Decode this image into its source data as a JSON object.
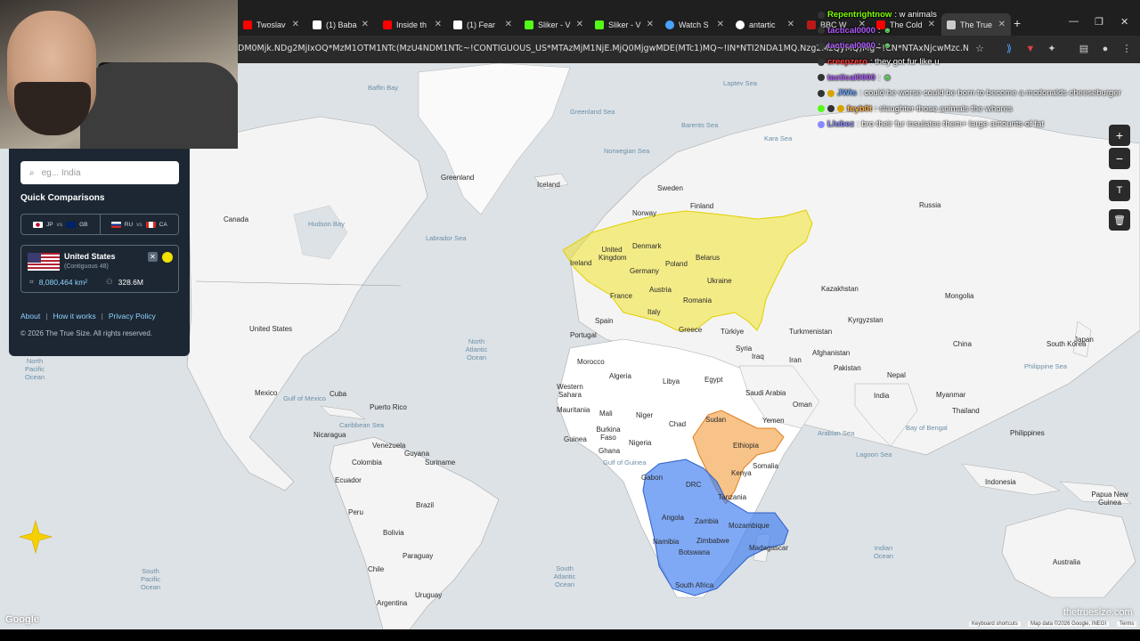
{
  "browser": {
    "tabs": [
      {
        "label": "Twoslav",
        "color": "#ff0000"
      },
      {
        "label": "(1) Baba",
        "color": "#ffffff"
      },
      {
        "label": "Inside th",
        "color": "#ff0000"
      },
      {
        "label": "(1) Fear",
        "color": "#ffffff"
      },
      {
        "label": "Sliker - V",
        "color": "#53fc18"
      },
      {
        "label": "Sliker - V",
        "color": "#53fc18"
      },
      {
        "label": "Watch S",
        "color": "#4aa3ff"
      },
      {
        "label": "antartic",
        "color": "#ffffff"
      },
      {
        "label": "BBC W",
        "color": "#bb1919"
      },
      {
        "label": "The Cold",
        "color": "#ff0000"
      },
      {
        "label": "The True",
        "color": "#cccccc"
      }
    ],
    "url": "DM0Mjk.NDg2MjIxOQ*MzM1OTM1NTc(MzU4NDM1NTc~!CONTIGUOUS_US*MTAzMjM1NjE.MjQ0MjgwMDE(MTc1)MQ~!IN*NTI2NDA1MQ.Nzg2MzQyMQ)Mg~!CN*NTAxNjcwMzc.Njk4NDc0OQ(Mji..."
  },
  "panel": {
    "search_placeholder": "eg... India",
    "quick_comparisons_title": "Quick Comparisons",
    "comparisons": [
      {
        "a": "JP",
        "vs": "vs",
        "b": "GB"
      },
      {
        "a": "RU",
        "vs": "vs",
        "b": "CA"
      }
    ],
    "selected": {
      "name": "United States",
      "subtitle": "(Contiguous 48)",
      "area": "8,080,464 km²",
      "population": "328.6M",
      "color": "#f2e000"
    },
    "links": [
      "About",
      "How it works",
      "Privacy Policy"
    ],
    "copyright": "© 2026 The True Size. All rights reserved."
  },
  "chat": [
    {
      "user": "Repentrightnow",
      "text": ": w animals",
      "color": "#7fff00"
    },
    {
      "user": "tactical0000",
      "text": ":",
      "color": "#b05cff"
    },
    {
      "user": "tactical0000",
      "text": ":",
      "color": "#b05cff"
    },
    {
      "user": "creepzero",
      "text": ": they got fur like u",
      "color": "#ff3b3b"
    },
    {
      "user": "tactical0000",
      "text": ":",
      "color": "#b05cff"
    },
    {
      "user": "JWis",
      "text": ": could be worse could be born to become a mcdonalds cheeseburger",
      "color": "#6fa8ff"
    },
    {
      "user": "feyb0t",
      "text": ": slaughter those animals the whores",
      "color": "#ffb347"
    },
    {
      "user": "Llubez",
      "text": ": bro their fur insulates them+ large amounts of fat",
      "color": "#8a8aff"
    }
  ],
  "map": {
    "labels": {
      "countries": [
        "Greenland",
        "Iceland",
        "Canada",
        "United States",
        "Mexico",
        "Cuba",
        "Puerto Rico",
        "Nicaragua",
        "Venezuela",
        "Colombia",
        "Guyana",
        "Suriname",
        "Ecuador",
        "Peru",
        "Brazil",
        "Bolivia",
        "Paraguay",
        "Chile",
        "Argentina",
        "Uruguay",
        "Sweden",
        "Finland",
        "Norway",
        "Russia",
        "United Kingdom",
        "Denmark",
        "Ireland",
        "Germany",
        "Poland",
        "Belarus",
        "Ukraine",
        "France",
        "Austria",
        "Romania",
        "Italy",
        "Spain",
        "Portugal",
        "Greece",
        "Türkiye",
        "Kazakhstan",
        "Mongolia",
        "Kyrgyzstan",
        "Turkmenistan",
        "China",
        "South Korea",
        "Japan",
        "Afghanistan",
        "Pakistan",
        "Iran",
        "Iraq",
        "Syria",
        "Nepal",
        "India",
        "Myanmar",
        "Thailand",
        "Philippines",
        "Indonesia",
        "Papua New Guinea",
        "Australia",
        "Morocco",
        "Algeria",
        "Libya",
        "Egypt",
        "Saudi Arabia",
        "Oman",
        "Yemen",
        "Western Sahara",
        "Mauritania",
        "Mali",
        "Niger",
        "Chad",
        "Sudan",
        "Ethiopia",
        "Somalia",
        "Kenya",
        "Guinea",
        "Burkina Faso",
        "Nigeria",
        "Ghana",
        "Gabon",
        "DRC",
        "Tanzania",
        "Angola",
        "Zambia",
        "Mozambique",
        "Zimbabwe",
        "Namibia",
        "Botswana",
        "Madagascar",
        "South Africa"
      ],
      "seas": [
        "Baffin Bay",
        "Hudson Bay",
        "Labrador Sea",
        "Norwegian Sea",
        "Greenland Sea",
        "Barents Sea",
        "Kara Sea",
        "Laptev Sea",
        "Arabian Sea",
        "Bay of Bengal",
        "Gulf of Mexico",
        "Caribbean Sea",
        "Philippine Sea",
        "Lagoon Sea"
      ],
      "oceans": [
        "North Atlantic Ocean",
        "North Pacific Ocean",
        "South Pacific Ocean",
        "South Atlantic Ocean",
        "Indian Ocean",
        "Gulf of Guinea"
      ]
    },
    "overlays": [
      {
        "country": "United States",
        "color": "#f2e000"
      },
      {
        "country": "India",
        "color": "#f29b3a"
      },
      {
        "country": "China",
        "color": "#3b7bf0"
      }
    ],
    "controls": {
      "zoom_in": "+",
      "zoom_out": "−",
      "text": "T",
      "delete": "🗑"
    },
    "google_logo": "Google",
    "attribution": [
      "Keyboard shortcuts",
      "Map data ©2026 Google, INEGI",
      "Terms"
    ],
    "brand": "thetruesize.com"
  }
}
